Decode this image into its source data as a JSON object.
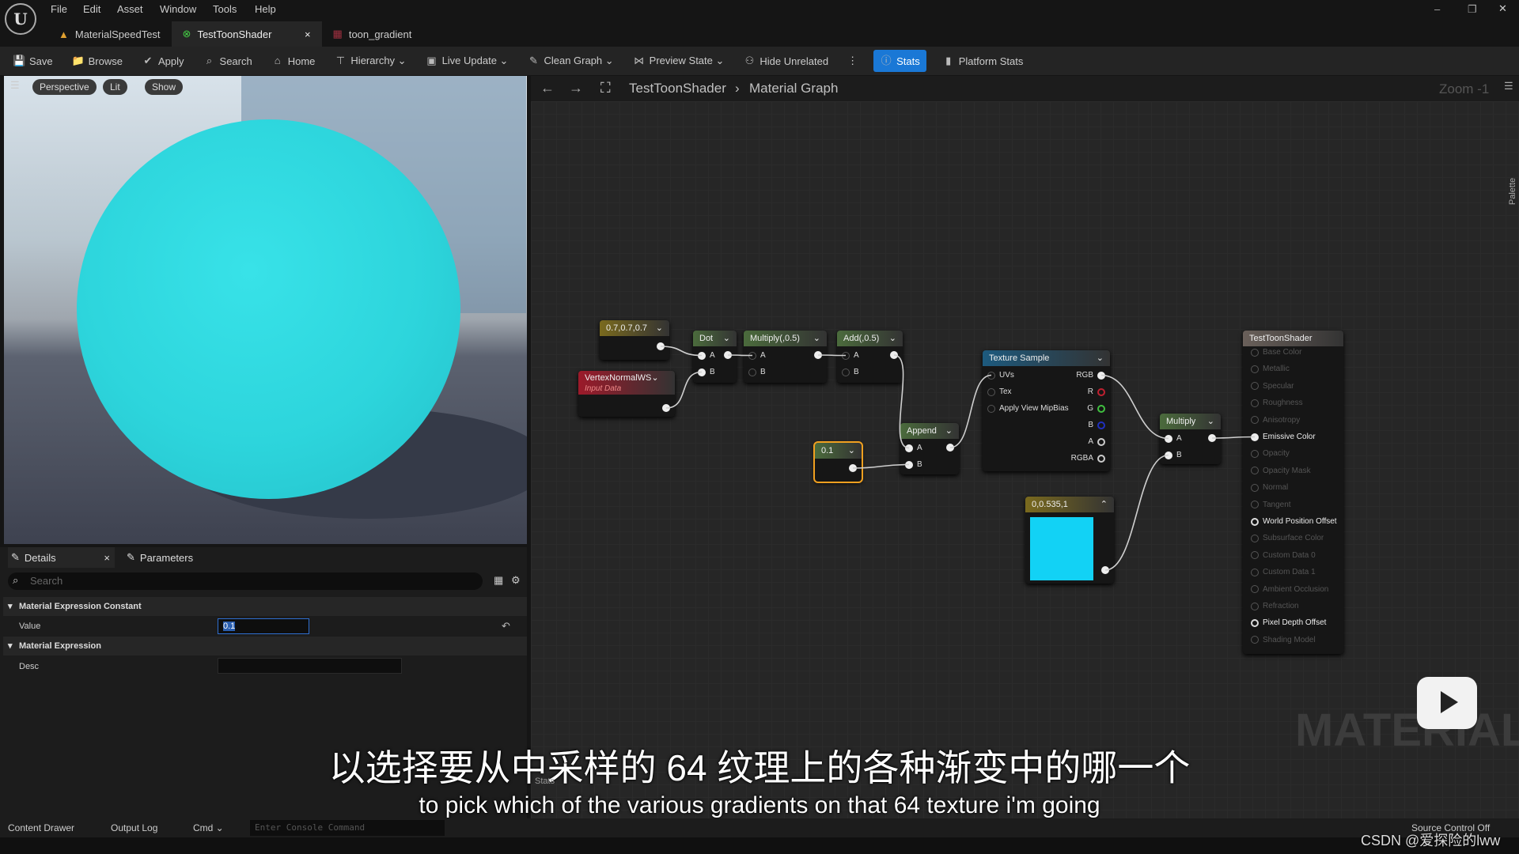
{
  "menu": [
    "File",
    "Edit",
    "Asset",
    "Window",
    "Tools",
    "Help"
  ],
  "tabs": [
    {
      "label": "MaterialSpeedTest"
    },
    {
      "label": "TestToonShader",
      "close": "×"
    },
    {
      "label": "toon_gradient"
    }
  ],
  "toolbar": [
    {
      "label": "Save",
      "icon": "save-icon",
      "g": "💾"
    },
    {
      "label": "Browse",
      "icon": "browse-icon",
      "g": "📁"
    },
    {
      "label": "Apply",
      "icon": "apply-icon",
      "g": "✔"
    },
    {
      "label": "Search",
      "icon": "search-icon",
      "g": "⌕"
    },
    {
      "label": "Home",
      "icon": "home-icon",
      "g": "⌂"
    },
    {
      "label": "Hierarchy ⌄",
      "icon": "hierarchy-icon",
      "g": "⊤"
    },
    {
      "label": "Live Update ⌄",
      "icon": "live-update-icon",
      "g": "▣"
    },
    {
      "label": "Clean Graph ⌄",
      "icon": "clean-graph-icon",
      "g": "✎"
    },
    {
      "label": "Preview State ⌄",
      "icon": "preview-state-icon",
      "g": "⋈"
    },
    {
      "label": "Hide Unrelated",
      "icon": "hide-unrelated-icon",
      "g": "⚇"
    },
    {
      "label": "⋮",
      "icon": "more-icon",
      "g": ""
    },
    {
      "label": "Stats",
      "icon": "stats-icon",
      "g": "ⓘ",
      "active": true
    },
    {
      "label": "Platform Stats",
      "icon": "platform-stats-icon",
      "g": "▮"
    }
  ],
  "viewport": {
    "perspective": "Perspective",
    "lit": "Lit",
    "show": "Show"
  },
  "graph": {
    "breadcrumb": [
      "TestToonShader",
      "Material Graph"
    ],
    "zoom": "Zoom -1",
    "palette": "Palette",
    "watermark": "MATERIAL",
    "nodes": {
      "c3": {
        "title": "0.7,0.7,0.7",
        "color": "#7a6a1e"
      },
      "vn": {
        "title": "VertexNormalWS",
        "subtitle": "Input Data",
        "color": "#9c1a2a"
      },
      "dot": {
        "title": "Dot",
        "color": "#4b6b3c",
        "pins": [
          "A",
          "B"
        ]
      },
      "mul1": {
        "title": "Multiply(,0.5)",
        "color": "#4b6b3c",
        "pins": [
          "A",
          "B"
        ]
      },
      "add": {
        "title": "Add(,0.5)",
        "color": "#4b6b3c",
        "pins": [
          "A",
          "B"
        ]
      },
      "c1": {
        "title": "0.1",
        "color": "#4b6b3c"
      },
      "app": {
        "title": "Append",
        "color": "#4b6b3c",
        "pins": [
          "A",
          "B"
        ]
      },
      "tex": {
        "title": "Texture Sample",
        "color": "#1d5a7e",
        "inputs": [
          "UVs",
          "Tex",
          "Apply View MipBias"
        ],
        "outputs": [
          "RGB",
          "R",
          "G",
          "B",
          "A",
          "RGBA"
        ]
      },
      "mul2": {
        "title": "Multiply",
        "color": "#4b6b3c",
        "pins": [
          "A",
          "B"
        ]
      },
      "c4": {
        "title": "0,0.535,1",
        "color": "#7a6a1e",
        "swatch": "#12d2f5"
      },
      "out": {
        "title": "TestToonShader",
        "color": "#6a605a",
        "inputs": [
          "Base Color",
          "Metallic",
          "Specular",
          "Roughness",
          "Anisotropy",
          "Emissive Color",
          "Opacity",
          "Opacity Mask",
          "Normal",
          "Tangent",
          "World Position Offset",
          "Subsurface Color",
          "Custom Data 0",
          "Custom Data 1",
          "Ambient Occlusion",
          "Refraction",
          "Pixel Depth Offset",
          "Shading Model"
        ],
        "active": [
          "Emissive Color",
          "World Position Offset",
          "Pixel Depth Offset"
        ]
      }
    }
  },
  "details": {
    "tab_details": "Details",
    "tab_parameters": "Parameters",
    "search_placeholder": "Search",
    "section1": "Material Expression Constant",
    "value_label": "Value",
    "value": "0.1",
    "section2": "Material Expression",
    "desc_label": "Desc"
  },
  "statusbar": {
    "content_drawer": "Content Drawer",
    "output_log": "Output Log",
    "cmd": "Cmd ⌄",
    "console_placeholder": "Enter Console Command",
    "source_control": "Source Control Off"
  },
  "subtitles": {
    "zh": "以选择要从中采样的 64 纹理上的各种渐变中的哪一个",
    "en": "to pick which of the various gradients on that 64 texture i'm going",
    "stats_tab": "Stats"
  },
  "watermark": "CSDN @爱探险的lww"
}
